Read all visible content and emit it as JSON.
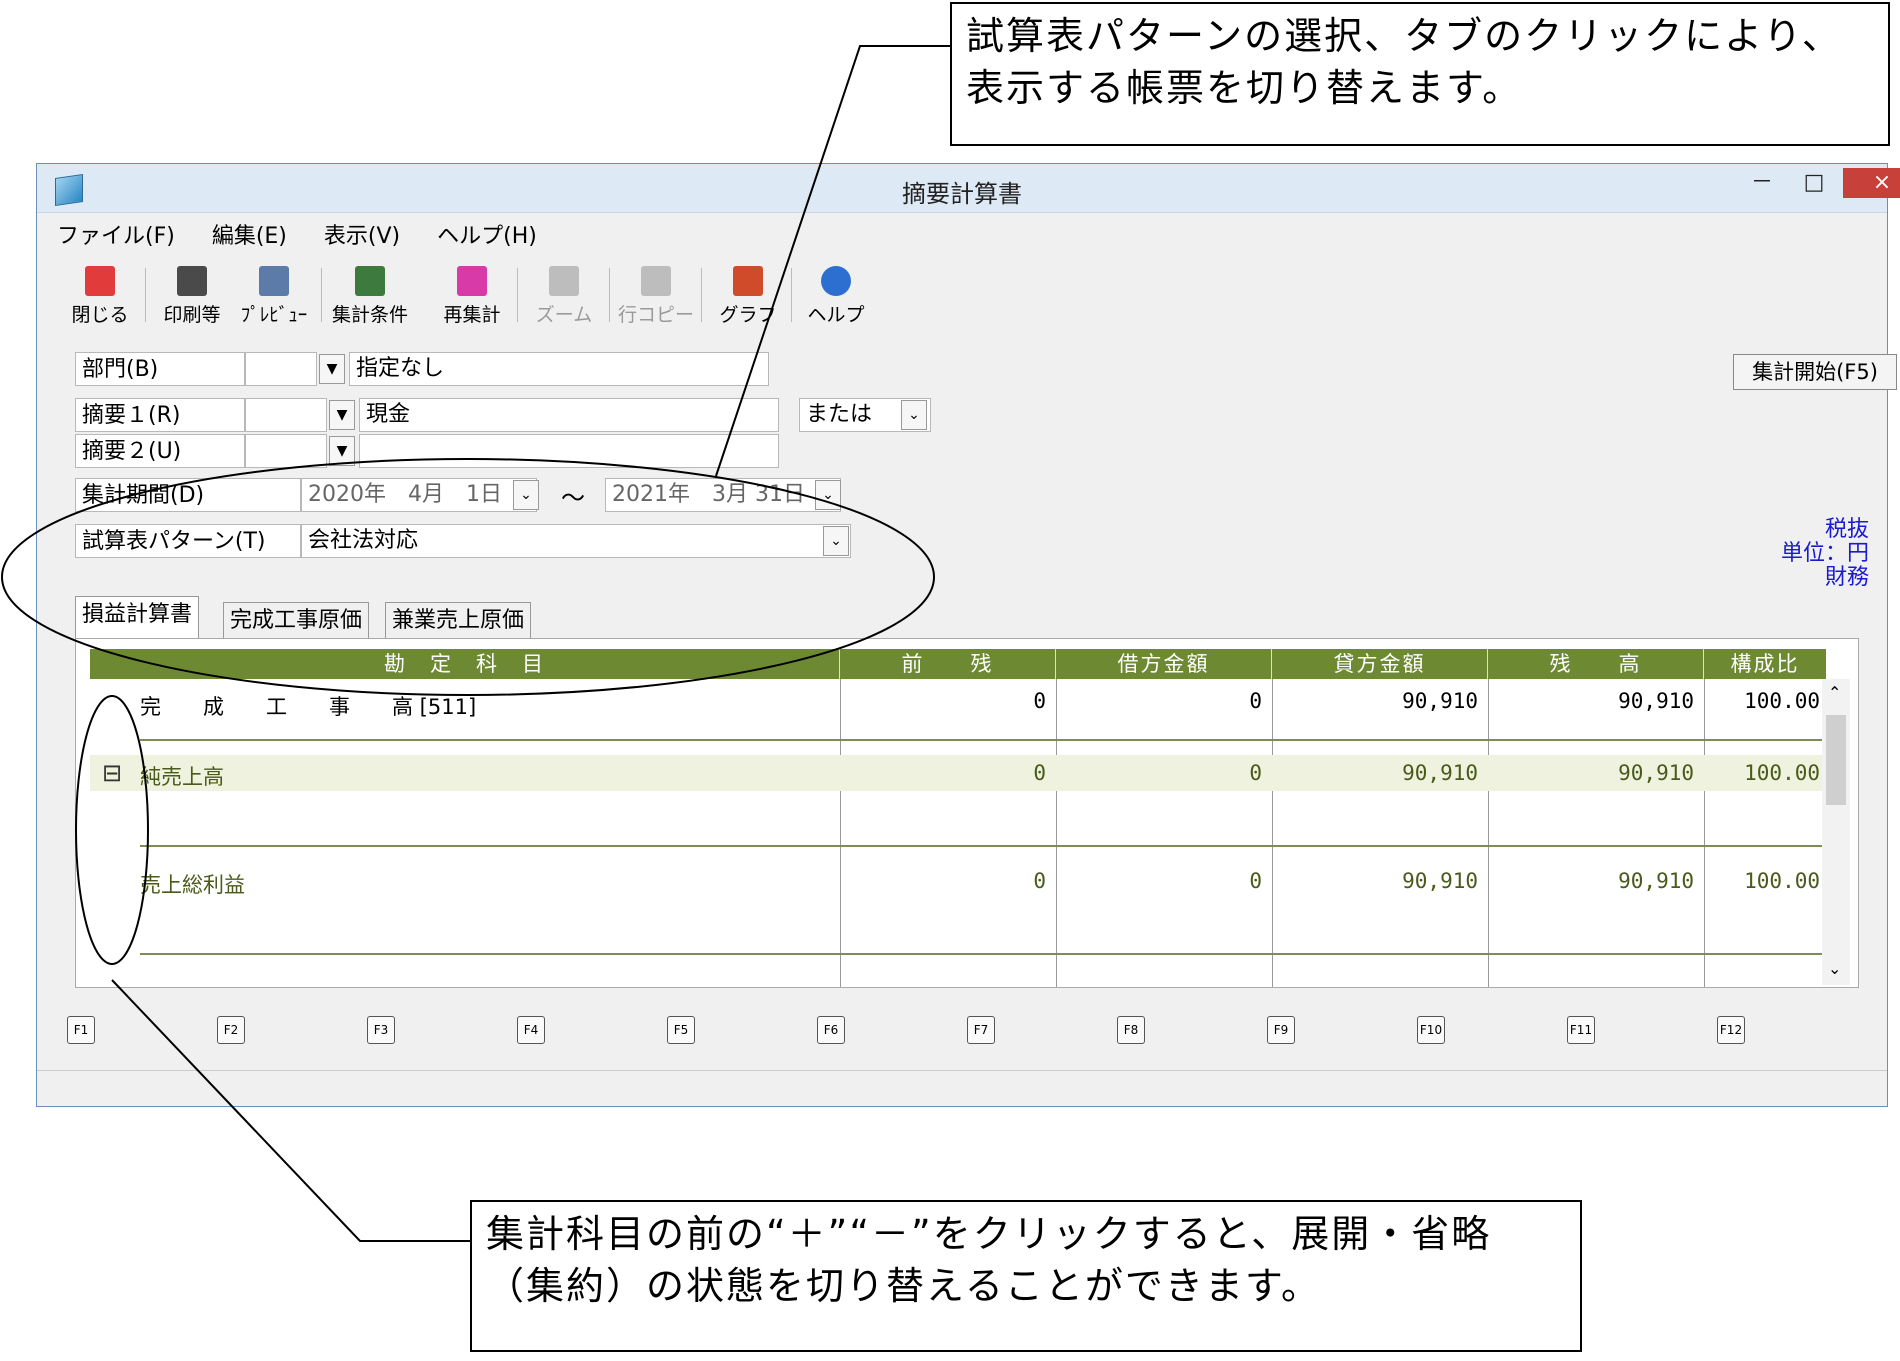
{
  "callouts": {
    "top": "試算表パターンの選択、タブのクリックにより、表示する帳票を切り替えます。",
    "bottom": "集計科目の前の“＋”“－”をクリックすると、展開・省略（集約）の状態を切り替えることができます。"
  },
  "window": {
    "title": "摘要計算書",
    "controls": {
      "minimize": "－",
      "maximize": "□",
      "close": "×"
    }
  },
  "menu": [
    "ファイル(F)",
    "編集(E)",
    "表示(V)",
    "ヘルプ(H)"
  ],
  "toolbar": [
    {
      "label": "閉じる",
      "icon": "close-icon",
      "color": "#e23b3b"
    },
    {
      "label": "印刷等",
      "icon": "printer-icon",
      "color": "#4a4a4a"
    },
    {
      "label": "ﾌﾟﾚﾋﾞｭｰ",
      "icon": "magnifier-icon",
      "color": "#5c7ba8"
    },
    {
      "label": "集計条件",
      "icon": "checklist-icon",
      "color": "#3d7a3d"
    },
    {
      "label": "再集計",
      "icon": "refresh-arrow-icon",
      "color": "#d83aa8"
    },
    {
      "label": "ズーム",
      "icon": "zoom-icon",
      "color": "#bdbdbd"
    },
    {
      "label": "行コピー",
      "icon": "copy-row-icon",
      "color": "#bdbdbd"
    },
    {
      "label": "グラフ",
      "icon": "chart-icon",
      "color": "#d04b2a"
    },
    {
      "label": "ヘルプ",
      "icon": "help-icon",
      "color": "#2d6fd0"
    }
  ],
  "form": {
    "dept_label": "部門(B)",
    "dept_value": "指定なし",
    "summary1_label": "摘要１(R)",
    "summary1_value": "現金",
    "summary2_label": "摘要２(U)",
    "summary2_value": "",
    "or_select": "または",
    "period_label": "集計期間(D)",
    "period_from": "2020年　4月　1日",
    "period_to": "2021年　3月 31日",
    "period_sep": "～",
    "pattern_label": "試算表パターン(T)",
    "pattern_value": "会社法対応",
    "start_button": "集計開始(F5)"
  },
  "units": {
    "line1": "税抜",
    "line2": "単位：円",
    "line3": "財務"
  },
  "tabs": [
    "損益計算書",
    "完成工事原価",
    "兼業売上原価"
  ],
  "grid": {
    "columns": [
      "勘　定　科　目",
      "前　　残",
      "借方金額",
      "貸方金額",
      "残　　高",
      "構成比"
    ],
    "rows": [
      {
        "account": "完　　成　　工　　事　　高 [511]",
        "prev": "0",
        "debit": "0",
        "credit": "90,910",
        "balance": "90,910",
        "ratio": "100.00",
        "toggle": "",
        "style": "plain"
      },
      {
        "account": "純売上高",
        "prev": "0",
        "debit": "0",
        "credit": "90,910",
        "balance": "90,910",
        "ratio": "100.00",
        "toggle": "⊟",
        "style": "green"
      },
      {
        "account": "売上総利益",
        "prev": "0",
        "debit": "0",
        "credit": "90,910",
        "balance": "90,910",
        "ratio": "100.00",
        "toggle": "",
        "style": "green"
      }
    ]
  },
  "fkeys": [
    "F1",
    "F2",
    "F3",
    "F4",
    "F5",
    "F6",
    "F7",
    "F8",
    "F9",
    "F10",
    "F11",
    "F12"
  ]
}
